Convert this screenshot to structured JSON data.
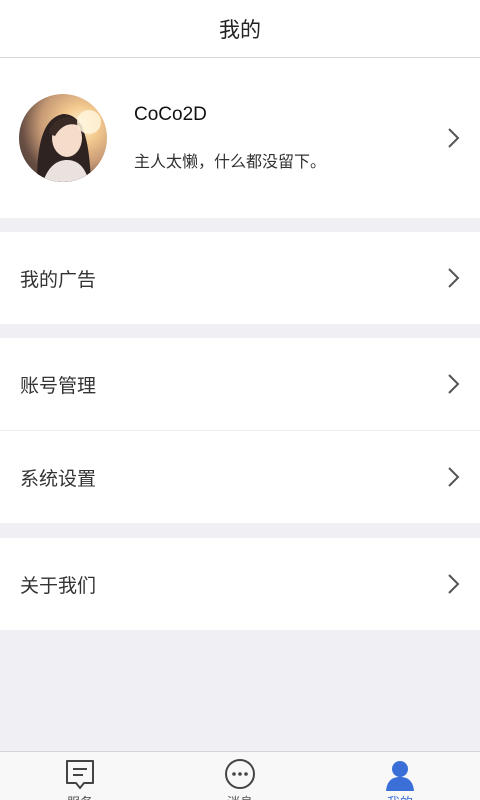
{
  "header": {
    "title": "我的"
  },
  "profile": {
    "name": "CoCo2D",
    "bio": "主人太懒，什么都没留下。"
  },
  "menu": [
    {
      "label": "我的广告"
    },
    {
      "label": "账号管理"
    },
    {
      "label": "系统设置"
    },
    {
      "label": "关于我们"
    }
  ],
  "tabbar": {
    "items": [
      {
        "label": "服务",
        "icon": "service-icon",
        "active": false
      },
      {
        "label": "消息",
        "icon": "message-icon",
        "active": false
      },
      {
        "label": "我的",
        "icon": "user-icon",
        "active": true
      }
    ]
  },
  "colors": {
    "accent": "#3a6fd8",
    "background": "#efeff4",
    "card": "#ffffff"
  }
}
